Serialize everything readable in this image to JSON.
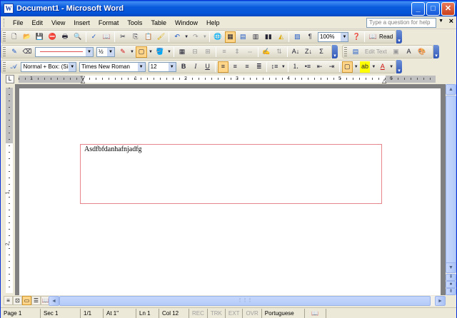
{
  "window": {
    "title": "Document1 - Microsoft Word",
    "app_icon": "W",
    "buttons": {
      "minimize": "_",
      "maximize": "□",
      "close": "✕"
    }
  },
  "menu": {
    "items": [
      "File",
      "Edit",
      "View",
      "Insert",
      "Format",
      "Tools",
      "Table",
      "Window",
      "Help"
    ],
    "help_placeholder": "Type a question for help",
    "close_doc": "×"
  },
  "standard_toolbar": {
    "zoom": "100%",
    "read_label": "Read"
  },
  "drawing_toolbar": {
    "line_weight": "½",
    "edit_text": "Edit Text"
  },
  "formatting_toolbar": {
    "style": "Normal + Box: (Sing",
    "font": "Times New Roman",
    "size": "12",
    "bold": "B",
    "italic": "I",
    "underline": "U"
  },
  "ruler": {
    "numbers": [
      "1",
      "1",
      "2",
      "3",
      "4",
      "5",
      "6"
    ],
    "vnumbers": [
      "1",
      "2"
    ]
  },
  "document": {
    "text": "Asdfbfdanhafnjadfg"
  },
  "status": {
    "page": "Page  1",
    "sec": "Sec  1",
    "pages": "1/1",
    "at": "At  1\"",
    "ln": "Ln  1",
    "col": "Col  12",
    "rec": "REC",
    "trk": "TRK",
    "ext": "EXT",
    "ovr": "OVR",
    "language": "Portuguese"
  }
}
